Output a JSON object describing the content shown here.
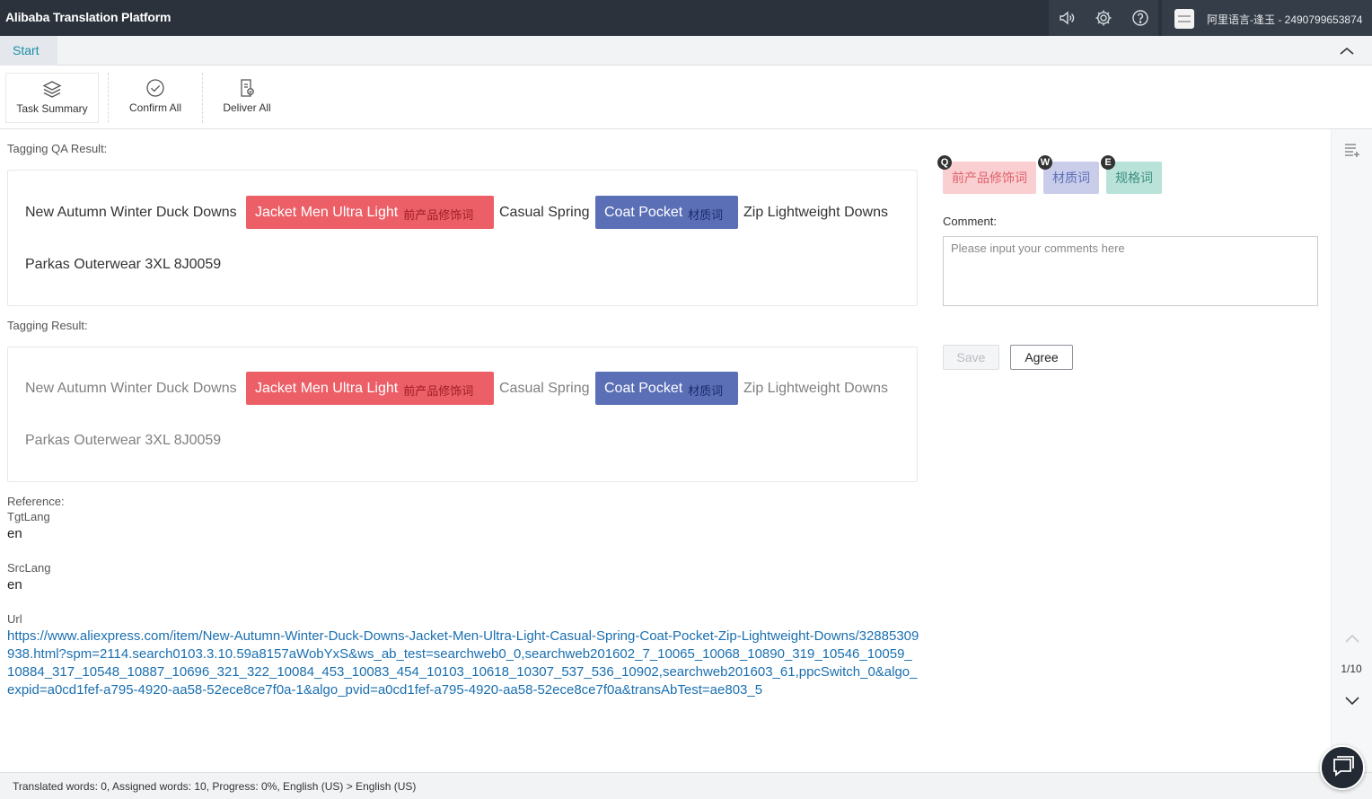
{
  "app": {
    "title": "Alibaba Translation Platform",
    "user": "阿里语言-逢玉 - 2490799653874"
  },
  "tabs": {
    "start": "Start"
  },
  "toolbar": {
    "task_summary": "Task Summary",
    "confirm_all": "Confirm All",
    "deliver_all": "Deliver All"
  },
  "qa": {
    "label": "Tagging QA Result:",
    "segments": {
      "s1": "New Autumn Winter Duck Downs",
      "tag1": "Jacket Men Ultra Light",
      "tag1_type": "前产品修饰词",
      "s2": "Casual Spring",
      "tag2": "Coat Pocket",
      "tag2_type": "材质词",
      "s3": "Zip Lightweight Downs",
      "s4": "Parkas Outerwear 3XL 8J0059"
    }
  },
  "result": {
    "label": "Tagging Result:",
    "segments": {
      "s1": "New Autumn Winter Duck Downs",
      "tag1": "Jacket Men Ultra Light",
      "tag1_type": "前产品修饰词",
      "s2": "Casual Spring",
      "tag2": "Coat Pocket",
      "tag2_type": "材质词",
      "s3": "Zip Lightweight Downs",
      "s4": "Parkas Outerwear 3XL 8J0059"
    }
  },
  "reference": {
    "label": "Reference:",
    "tgt_label": "TgtLang",
    "tgt_value": "en",
    "src_label": "SrcLang",
    "src_value": "en",
    "url_label": "Url",
    "url_value": "https://www.aliexpress.com/item/New-Autumn-Winter-Duck-Downs-Jacket-Men-Ultra-Light-Casual-Spring-Coat-Pocket-Zip-Lightweight-Downs/32885309938.html?spm=2114.search0103.3.10.59a8157aWobYxS&ws_ab_test=searchweb0_0,searchweb201602_7_10065_10068_10890_319_10546_10059_10884_317_10548_10887_10696_321_322_10084_453_10083_454_10103_10618_10307_537_536_10902,searchweb201603_61,ppcSwitch_0&algo_expid=a0cd1fef-a795-4920-aa58-52ece8ce7f0a-1&algo_pvid=a0cd1fef-a795-4920-aa58-52ece8ce7f0a&transAbTest=ae803_5"
  },
  "legend": [
    {
      "key": "Q",
      "label": "前产品修饰词"
    },
    {
      "key": "W",
      "label": "材质词"
    },
    {
      "key": "E",
      "label": "规格词"
    }
  ],
  "comment": {
    "label": "Comment:",
    "placeholder": "Please input your comments here"
  },
  "buttons": {
    "save": "Save",
    "agree": "Agree"
  },
  "pager": {
    "text": "1/10"
  },
  "status": {
    "text": "Translated words: 0, Assigned words: 10, Progress: 0%, English (US) > English (US)"
  },
  "colors": {
    "tag_red": "#ec5f67",
    "tag_blue": "#5b6fb7",
    "link": "#1a6fb0",
    "topbar": "#2b323c"
  }
}
